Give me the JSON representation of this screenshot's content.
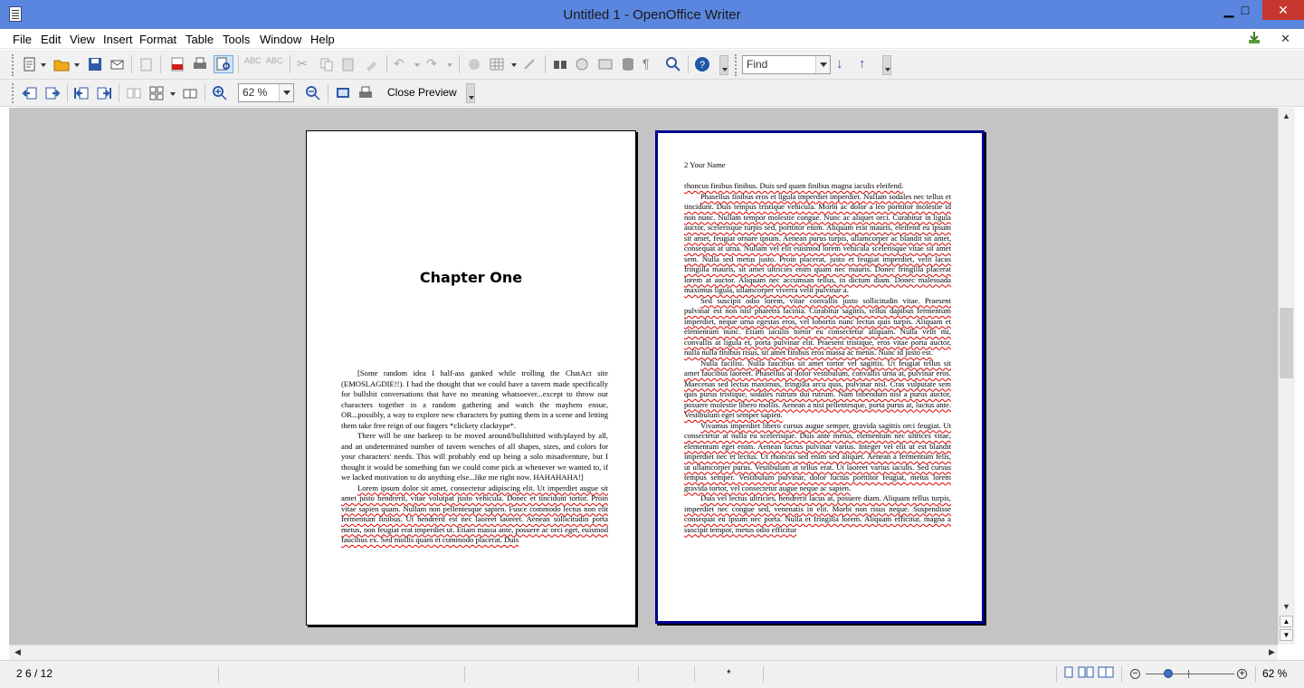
{
  "window": {
    "title": "Untitled 1 - OpenOffice Writer",
    "minimize": "▁",
    "maximize": "□",
    "close": "✕"
  },
  "menu": [
    "File",
    "Edit",
    "View",
    "Insert",
    "Format",
    "Table",
    "Tools",
    "Window",
    "Help"
  ],
  "menu_right": {
    "close": "✕"
  },
  "find": {
    "placeholder": "Find"
  },
  "preview": {
    "zoom": "62 %",
    "close_label": "Close Preview"
  },
  "page1": {
    "chapter": "Chapter One",
    "p1": "[Some random idea I half-ass ganked while trolling the ChatAct site (EMOSLAGDIE!!). I had the thought that we could have a tavern made specifically for bullshit conversations that have no meaning whatsoever...except to throw our characters together in a random gathering and watch the mayhem ensue, OR...possibly, a way to explore new characters by putting them in a scene and letting them take free reign of our fingers *clickety clacktype*.",
    "p2": "There will be one barkeep to be moved around/bullshitted with/played by all, and an undetermined number of tavern wenches of all shapes, sizes, and colors for your characters' needs. This will probably end up being a solo misadventure, but I thought it would be something fun we could come pick at whenever we wanted to, if we lacked motivation to do anything else...like me right now. HAHAHAHA!]",
    "p3": "Lorem ipsum dolor sit amet, consectetur adipiscing elit. Ut imperdiet augue sit amet justo hendrerit, vitae volutpat justo vehicula. Donec et tincidunt tortor. Proin vitae sapien quam. Nullam non pellentesque sapien. Fusce commodo lectus non elit fermentum finibus. Ut hendrerit est nec laoreet laoreet. Aenean sollicitudin porta metus, non feugiat erat imperdiet ut. Etiam massa ante, posuere ac orci eget, euismod faucibus ex. Sed mollis quam et commodo placerat. Duis"
  },
  "page2": {
    "header": "2 Your Name",
    "p0": "rhoncus finibus finibus. Duis sed quam finibus magna iaculis eleifend.",
    "p1": "Phasellus finibus eros et ligula imperdiet imperdiet. Nullam sodales nec tellus et tincidunt. Duis tempus tristique vehicula. Morbi ac dolor a leo porttitor molestie id non nunc. Nullam tempor molestie congue. Nunc ac aliquet orci. Curabitur in ligula auctor, scelerisque turpis sed, porttitor enim. Aliquam erat mauris, eleifend eu ipsum sit amet, feugiat ornare ipsum. Aenean purus turpis, ullamcorper ac blandit sit amet, consequat at urna. Nullam vel elit euismod lorem vehicula scelerisque vitae sit amet sem. Nulla sed metus justo. Proin placerat, justo et feugiat imperdiet, velit lacus fringilla mauris, sit amet ultricies enim quam nec mauris. Donec fringilla placerat lorem at auctor. Aliquam nec accumsan tellus, in dictum diam. Donec malesuada maximus ligula, ullamcorper viverra velit pulvinar a.",
    "p2": "Sed suscipit odio lorem, vitae convallis justo sollicitudin vitae. Praesent pulvinar est non nisl pharetra lacinia. Curabitur sagittis, tellus dapibus fermentum imperdiet, neque urna egestas eros, vel lobortis nunc lectus quis turpis. Aliquam et elementum nunc. Etiam iaculis tortor eu consectetur aliquam. Nulla velit mi, convallis at ligula et, porta pulvinar elit. Praesent tristique, eros vitae porta auctor, nulla nulla finibus risus, sit amet finibus eros massa ac metus. Nunc id justo est.",
    "p3": "Nulla facilisi. Nulla faucibus sit amet tortor vel sagittis. Ut feugiat tellus sit amet faucibus laoreet. Phasellus at dolor vestibulum, convallis urna at, pulvinar eros. Maecenas sed lectus maximus, fringilla arcu quis, pulvinar nisl. Cras vulputate sem quis purus tristique, sodales rutrum dui rutrum. Nam bibendum nisl a purus auctor, posuere molestie libero mollis. Aenean a nisi pellentesque, porta purus at, luctus ante. Vestibulum eget semper sapien.",
    "p4": "Vivamus imperdiet libero cursus augue semper, gravida sagittis orci feugiat. Ut consectetur at nulla eu scelerisque. Duis ante metus, elementum nec ultrices vitae, elementum eget enim. Aenean luctus pulvinar varius. Integer vel elit ut est blandit imperdiet nec et lectus. Ut rhoncus sed enim sed aliquet. Aenean a fermentum felis, ut ullamcorper purus. Vestibulum at tellus erat. Ut laoreet varius iaculis. Sed cursus tempus semper. Vestibulum pulvinar, dolor luctus porttitor feugiat, metus lorem gravida tortor, vel consectetur augue neque ac sapien.",
    "p5": "Duis vel lectus ultricies, hendrerit lacus at, posuere diam. Aliquam tellus turpis, imperdiet nec congue sed, venenatis in elit. Morbi non risus neque. Suspendisse consequat eu ipsum nec porta. Nulla et fringilla lorem. Aliquam efficitur, magna a suscipit tempor, metus odio efficitur"
  },
  "status": {
    "page": "2 6 / 12",
    "modified": "*",
    "zoom": "62 %"
  }
}
